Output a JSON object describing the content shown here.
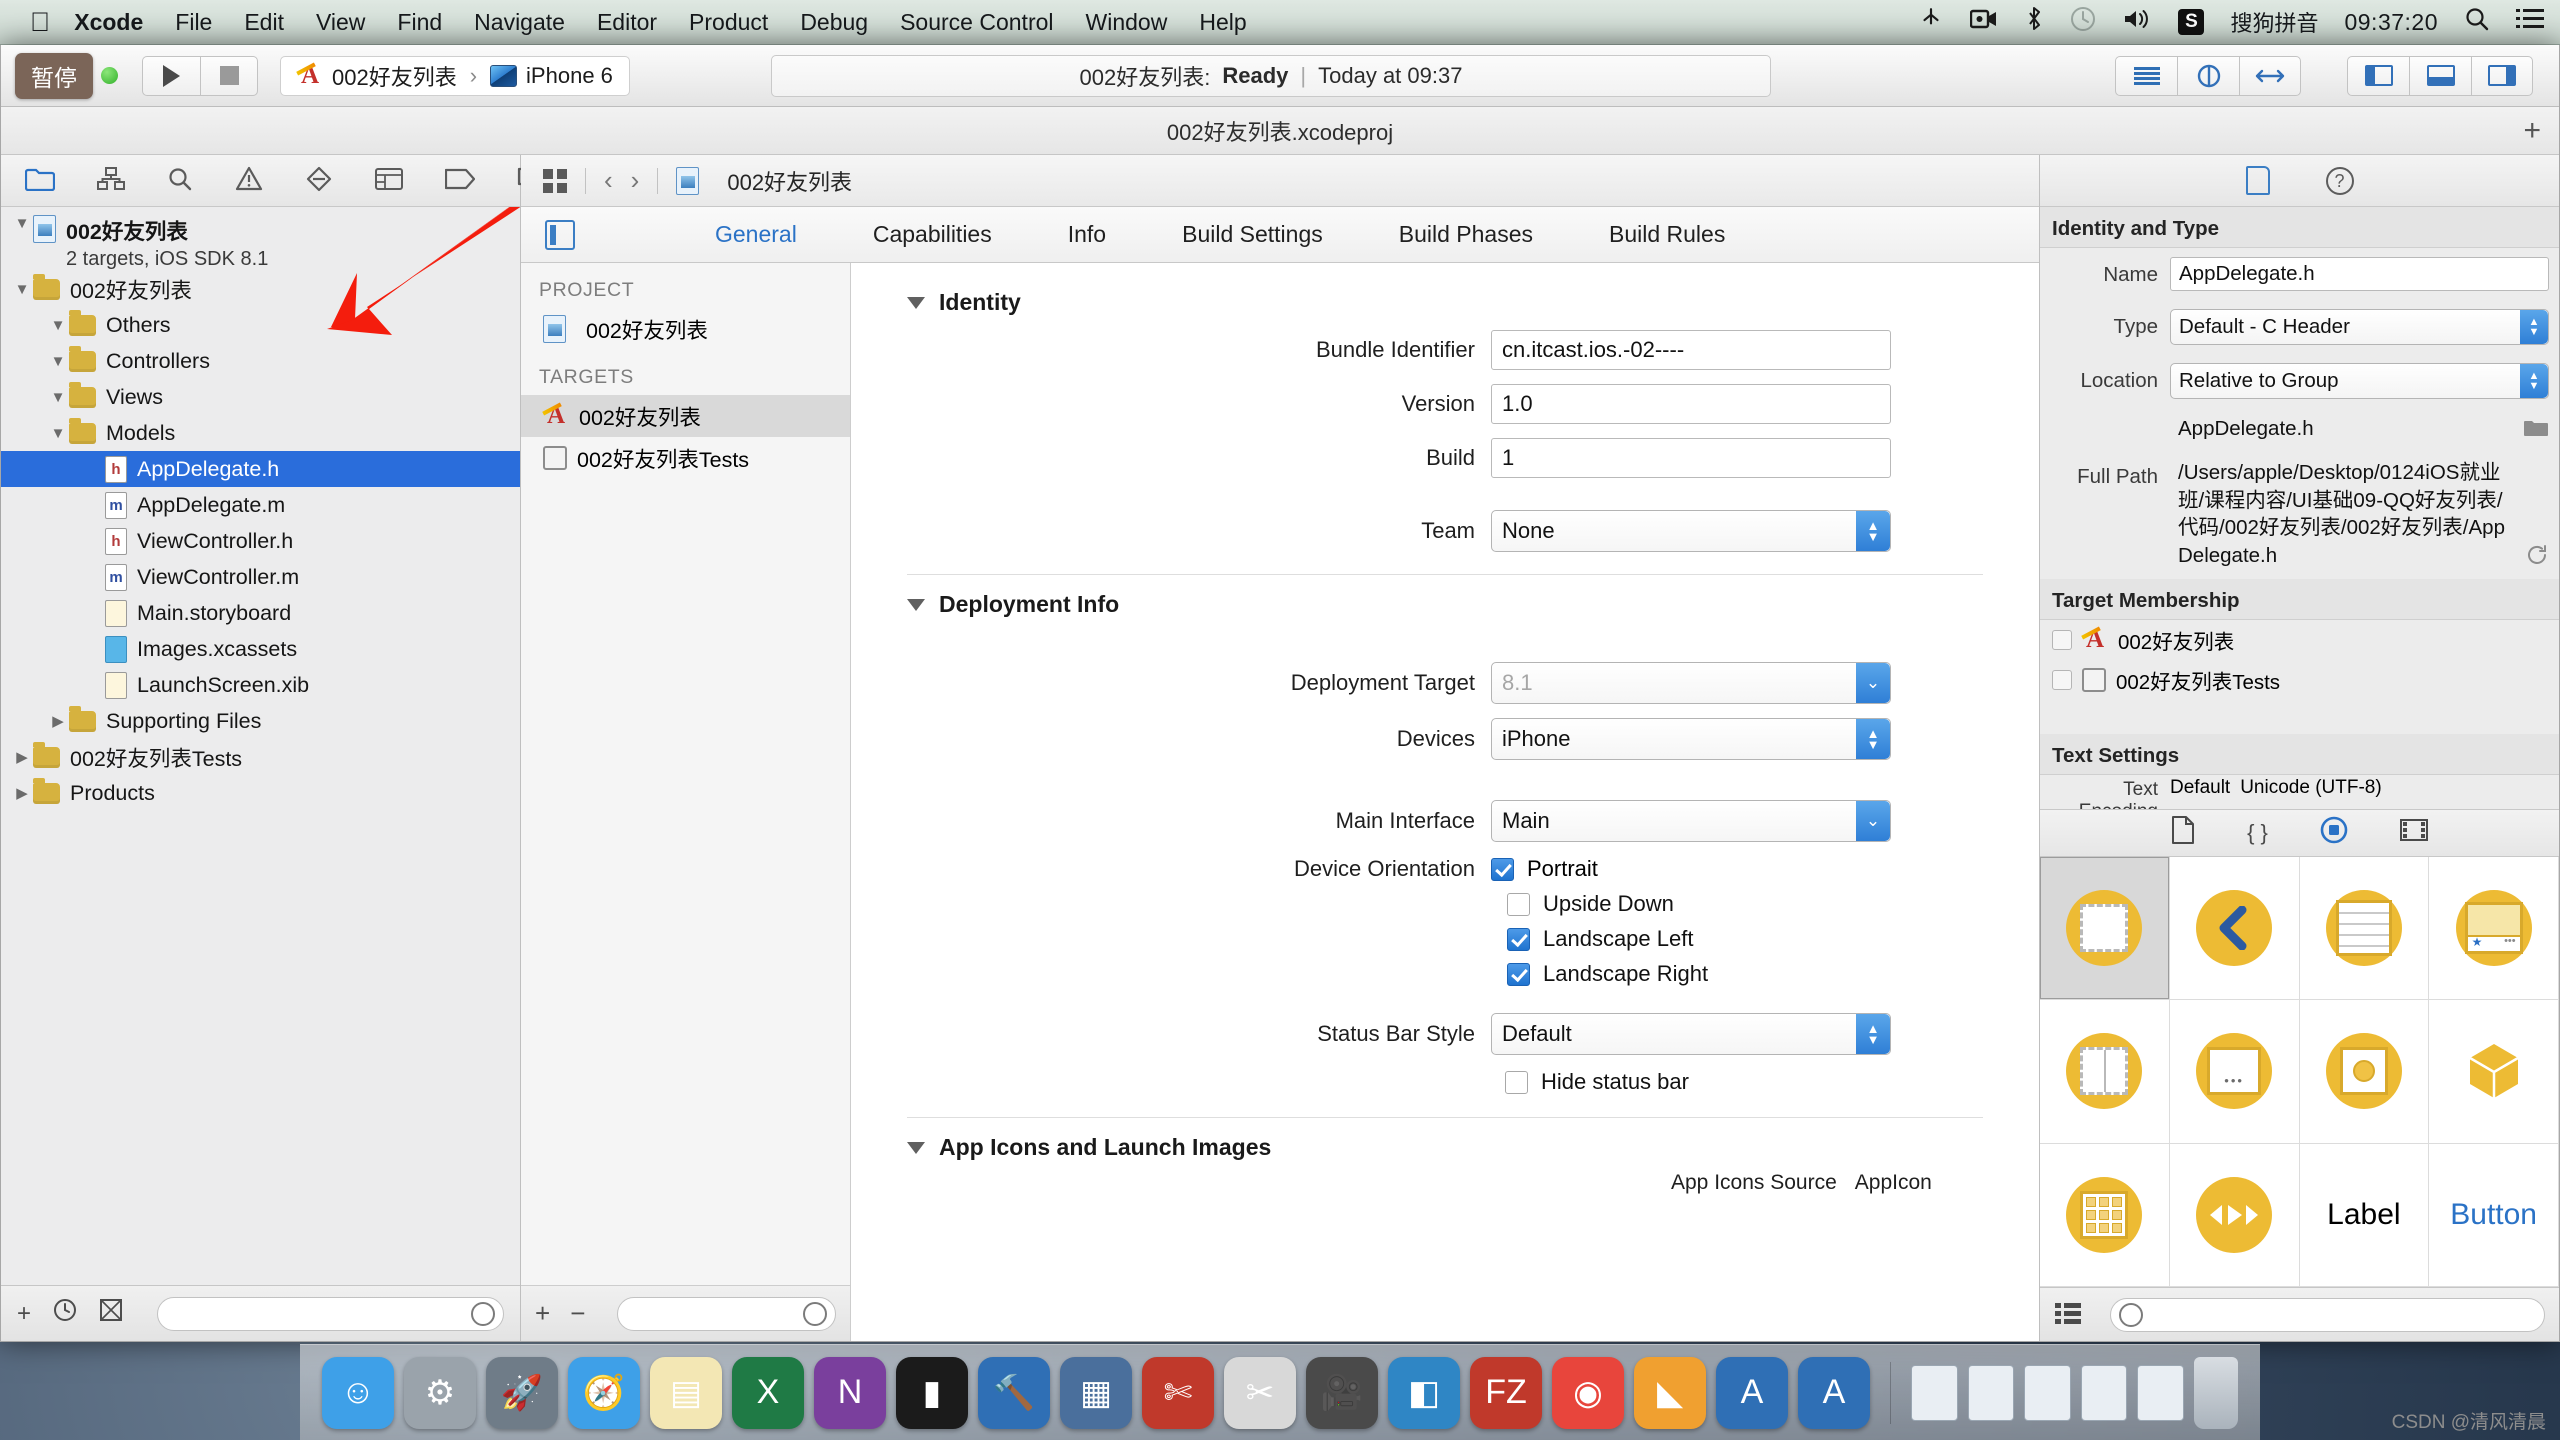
{
  "menubar": {
    "apple_glyph": "",
    "items": [
      "Xcode",
      "File",
      "Edit",
      "View",
      "Find",
      "Navigate",
      "Editor",
      "Product",
      "Debug",
      "Source Control",
      "Window",
      "Help"
    ],
    "status": {
      "bluetooth_share_icon": "share-icon",
      "screen_record_icon": "video-icon",
      "airplay_icon": "bluetooth-icon",
      "timemachine_icon": "clock-icon",
      "volume_icon": "volume-icon",
      "input_badge": "S",
      "input_method": "搜狗拼音",
      "clock": "09:37:20",
      "search_icon": "search-icon",
      "notification_icon": "list-icon"
    }
  },
  "toolbar": {
    "tooltip": "暂停",
    "run_label": "run-button",
    "stop_label": "stop-button",
    "scheme_project": "002好友列表",
    "scheme_separator": "›",
    "scheme_device": "iPhone 6",
    "status_project": "002好友列表:",
    "status_state": "Ready",
    "status_separator": "|",
    "status_time": "Today at 09:37"
  },
  "window": {
    "title": "002好友列表.xcodeproj",
    "add_tab": "+"
  },
  "navigator": {
    "tabs": [
      "folder-icon",
      "hierarchy-icon",
      "search-icon",
      "warning-icon",
      "breakpoint-icon",
      "report-icon",
      "test-icon",
      "debug-icon"
    ],
    "project": {
      "name": "002好友列表",
      "subtitle": "2 targets, iOS SDK 8.1"
    },
    "tree": [
      {
        "label": "002好友列表",
        "kind": "folder",
        "depth": 1,
        "twisty": "▼"
      },
      {
        "label": "Others",
        "kind": "folder",
        "depth": 2,
        "twisty": "▼"
      },
      {
        "label": "Controllers",
        "kind": "folder",
        "depth": 2,
        "twisty": "▼"
      },
      {
        "label": "Views",
        "kind": "folder",
        "depth": 2,
        "twisty": "▼"
      },
      {
        "label": "Models",
        "kind": "folder",
        "depth": 2,
        "twisty": "▼"
      },
      {
        "label": "AppDelegate.h",
        "kind": "h",
        "depth": 3,
        "twisty": "",
        "selected": true
      },
      {
        "label": "AppDelegate.m",
        "kind": "m",
        "depth": 3,
        "twisty": ""
      },
      {
        "label": "ViewController.h",
        "kind": "h",
        "depth": 3,
        "twisty": ""
      },
      {
        "label": "ViewController.m",
        "kind": "m",
        "depth": 3,
        "twisty": ""
      },
      {
        "label": "Main.storyboard",
        "kind": "sb",
        "depth": 3,
        "twisty": ""
      },
      {
        "label": "Images.xcassets",
        "kind": "xc",
        "depth": 3,
        "twisty": ""
      },
      {
        "label": "LaunchScreen.xib",
        "kind": "xib",
        "depth": 3,
        "twisty": ""
      },
      {
        "label": "Supporting Files",
        "kind": "folder",
        "depth": 2,
        "twisty": "▶"
      },
      {
        "label": "002好友列表Tests",
        "kind": "folder",
        "depth": 1,
        "twisty": "▶"
      },
      {
        "label": "Products",
        "kind": "folder",
        "depth": 1,
        "twisty": "▶"
      }
    ],
    "bottom": {
      "add": "+",
      "history_icon": "clock-icon",
      "filter_icon": "filter-icon",
      "filter_placeholder": ""
    }
  },
  "editor": {
    "jumpbar": {
      "grid_icon": "grid-icon",
      "back": "‹",
      "forward": "›",
      "breadcrumb": "002好友列表"
    },
    "tabs": [
      {
        "label": "General",
        "active": true
      },
      {
        "label": "Capabilities",
        "active": false
      },
      {
        "label": "Info",
        "active": false
      },
      {
        "label": "Build Settings",
        "active": false
      },
      {
        "label": "Build Phases",
        "active": false
      },
      {
        "label": "Build Rules",
        "active": false
      }
    ],
    "targets_panel": {
      "project_header": "PROJECT",
      "project_item": "002好友列表",
      "targets_header": "TARGETS",
      "targets": [
        {
          "label": "002好友列表",
          "selected": true
        },
        {
          "label": "002好友列表Tests",
          "selected": false
        }
      ],
      "add": "+",
      "remove": "−",
      "filter_icon": "filter-icon"
    },
    "identity": {
      "section_title": "Identity",
      "fields": [
        {
          "label": "Bundle Identifier",
          "value": "cn.itcast.ios.-02----",
          "type": "text"
        },
        {
          "label": "Version",
          "value": "1.0",
          "type": "text"
        },
        {
          "label": "Build",
          "value": "1",
          "type": "text"
        },
        {
          "label": "Team",
          "value": "None",
          "type": "combo"
        }
      ]
    },
    "deployment": {
      "section_title": "Deployment Info",
      "deployment_target_label": "Deployment Target",
      "deployment_target_value": "8.1",
      "devices_label": "Devices",
      "devices_value": "iPhone",
      "main_interface_label": "Main Interface",
      "main_interface_value": "Main",
      "orientation_label": "Device Orientation",
      "orientations": [
        {
          "label": "Portrait",
          "checked": true
        },
        {
          "label": "Upside Down",
          "checked": false
        },
        {
          "label": "Landscape Left",
          "checked": true
        },
        {
          "label": "Landscape Right",
          "checked": true
        }
      ],
      "status_bar_style_label": "Status Bar Style",
      "status_bar_style_value": "Default",
      "hide_status_bar_label": "Hide status bar",
      "hide_status_bar_checked": false
    },
    "app_icons": {
      "section_title": "App Icons and Launch Images",
      "source_label": "App Icons Source",
      "source_value": "AppIcon"
    }
  },
  "inspector": {
    "tabs": [
      "file-inspector-icon",
      "quick-help-icon"
    ],
    "identity_and_type": {
      "title": "Identity and Type",
      "name_label": "Name",
      "name_value": "AppDelegate.h",
      "type_label": "Type",
      "type_value": "Default - C Header",
      "location_label": "Location",
      "location_value": "Relative to Group",
      "file_name": "AppDelegate.h",
      "full_path_label": "Full Path",
      "full_path_value": "/Users/apple/Desktop/0124iOS就业班/课程内容/UI基础09-QQ好友列表/代码/002好友列表/002好友列表/AppDelegate.h"
    },
    "target_membership": {
      "title": "Target Membership",
      "items": [
        {
          "label": "002好友列表",
          "checked": false
        },
        {
          "label": "002好友列表Tests",
          "checked": false
        }
      ]
    },
    "text_settings": {
      "title": "Text Settings",
      "encoding_label": "Text Encoding",
      "encoding_default": "Default",
      "encoding_value": "Unicode (UTF-8)"
    },
    "library": {
      "tabs": [
        "file-template-icon",
        "code-snippet-icon",
        "object-library-icon",
        "media-library-icon"
      ],
      "selected_tab_index": 2,
      "objects": [
        {
          "name": "view-controller",
          "label": ""
        },
        {
          "name": "navigation-controller",
          "label": ""
        },
        {
          "name": "table-view-controller",
          "label": ""
        },
        {
          "name": "tab-bar-controller",
          "label": ""
        },
        {
          "name": "split-view-controller",
          "label": ""
        },
        {
          "name": "page-view-controller",
          "label": ""
        },
        {
          "name": "collection-view-controller",
          "label": ""
        },
        {
          "name": "object-cube",
          "label": ""
        },
        {
          "name": "collection-view",
          "label": ""
        },
        {
          "name": "avplayer-controller",
          "label": ""
        },
        {
          "name": "label",
          "label": "Label"
        },
        {
          "name": "button",
          "label": "Button"
        }
      ],
      "bottom": {
        "list_icon": "list-icon",
        "filter_placeholder": ""
      }
    }
  },
  "dock": {
    "apps": [
      {
        "name": "finder",
        "glyph": "☺",
        "color": "#3ea0e8"
      },
      {
        "name": "system-preferences",
        "glyph": "⚙",
        "color": "#9aa3ab"
      },
      {
        "name": "launchpad",
        "glyph": "🚀",
        "color": "#6f7c88"
      },
      {
        "name": "safari",
        "glyph": "🧭",
        "color": "#3ea0e8"
      },
      {
        "name": "notes",
        "glyph": "▤",
        "color": "#f3e7b4"
      },
      {
        "name": "excel",
        "glyph": "X",
        "color": "#1f7a45"
      },
      {
        "name": "onenote",
        "glyph": "N",
        "color": "#7a3f9d"
      },
      {
        "name": "terminal",
        "glyph": "▮",
        "color": "#1b1b1b"
      },
      {
        "name": "xcode-beta",
        "glyph": "🔨",
        "color": "#2f6fb5"
      },
      {
        "name": "instruments",
        "glyph": "▦",
        "color": "#4a6f9c"
      },
      {
        "name": "scissors-app",
        "glyph": "✄",
        "color": "#c0392b"
      },
      {
        "name": "snip",
        "glyph": "✂",
        "color": "#d8d8d8"
      },
      {
        "name": "quicktime",
        "glyph": "🎥",
        "color": "#4a4a4a"
      },
      {
        "name": "keynote",
        "glyph": "◧",
        "color": "#2f86c5"
      },
      {
        "name": "filezilla",
        "glyph": "FZ",
        "color": "#c0392b"
      },
      {
        "name": "chrome",
        "glyph": "◉",
        "color": "#e8453c"
      },
      {
        "name": "sketch",
        "glyph": "◣",
        "color": "#f0a030"
      },
      {
        "name": "xcode-a",
        "glyph": "A",
        "color": "#2f6fb5"
      },
      {
        "name": "xcode-b",
        "glyph": "A",
        "color": "#2f6fb5"
      }
    ],
    "trash": "trash-icon"
  },
  "watermark": "CSDN @清风清晨"
}
